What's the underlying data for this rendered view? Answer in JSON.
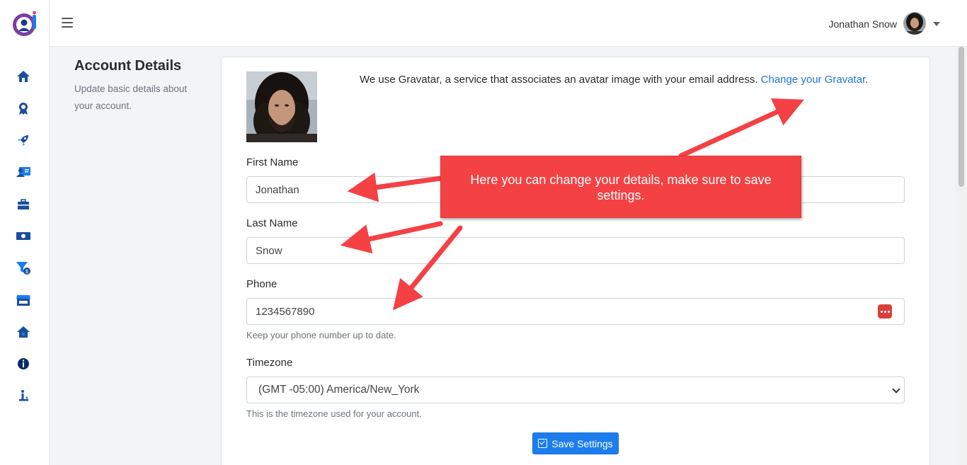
{
  "header": {
    "user_name": "Jonathan Snow"
  },
  "sidebar": {
    "items": [
      {
        "icon": "home-icon"
      },
      {
        "icon": "award-icon"
      },
      {
        "icon": "rocket-icon"
      },
      {
        "icon": "contact-card-icon"
      },
      {
        "icon": "toolbox-icon"
      },
      {
        "icon": "money-icon"
      },
      {
        "icon": "filter-dollar-icon"
      },
      {
        "icon": "store-icon"
      },
      {
        "icon": "home-alt-icon"
      },
      {
        "icon": "info-circle-icon"
      },
      {
        "icon": "user-info-icon"
      }
    ]
  },
  "section": {
    "title": "Account Details",
    "description": "Update basic details about your account."
  },
  "gravatar": {
    "text": "We use Gravatar, a service that associates an avatar image with your email address. ",
    "link": "Change your Gravatar",
    "suffix": "."
  },
  "form": {
    "first_name_label": "First Name",
    "first_name_value": "Jonathan",
    "last_name_label": "Last Name",
    "last_name_value": "Snow",
    "phone_label": "Phone",
    "phone_value": "1234567890",
    "phone_help": "Keep your phone number up to date.",
    "timezone_label": "Timezone",
    "timezone_value": "(GMT -05:00) America/New_York",
    "timezone_help": "This is the timezone used for your account.",
    "save_label": "Save Settings"
  },
  "callout": {
    "text": "Here you can change your details, make sure to save settings."
  },
  "colors": {
    "accent": "#1c7ded",
    "sidebar_icon": "#1a4f9c",
    "annotation_red": "#f44144"
  }
}
